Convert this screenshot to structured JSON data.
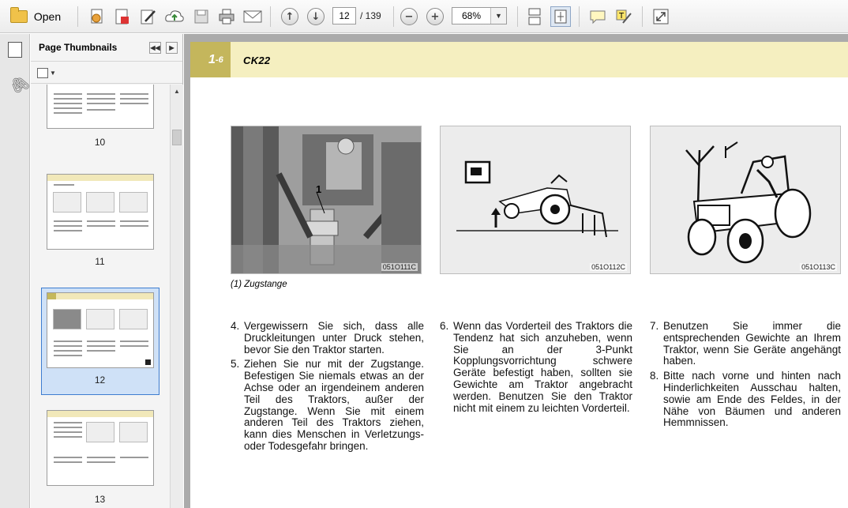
{
  "toolbar": {
    "open_label": "Open",
    "page_current": "12",
    "page_total": "/ 139",
    "zoom": "68%"
  },
  "panel": {
    "title": "Page Thumbnails",
    "thumbnails": [
      {
        "label": "10",
        "selected": false
      },
      {
        "label": "11",
        "selected": false
      },
      {
        "label": "12",
        "selected": true
      },
      {
        "label": "13",
        "selected": false
      }
    ]
  },
  "document": {
    "section_tag": "1",
    "section_tag_sub": "-6",
    "header_title": "CK22",
    "figures": [
      {
        "code": "051O111C",
        "callout": "1"
      },
      {
        "code": "051O112C"
      },
      {
        "code": "051O113C"
      }
    ],
    "caption": "(1)  Zugstange",
    "items": [
      {
        "num": "4.",
        "text": "Vergewissern Sie sich, dass alle Druckleitungen unter Druck stehen, bevor Sie den  Traktor starten."
      },
      {
        "num": "5.",
        "text": "Ziehen Sie nur mit der Zugstange. Befestigen Sie niemals etwas an der Achse oder an irgendeinem anderen Teil des Traktors, außer der Zugstange. Wenn Sie mit einem anderen Teil des Traktors ziehen, kann dies Menschen in Verletzungs- oder Todesgefahr bringen."
      },
      {
        "num": "6.",
        "text": "Wenn das Vorderteil des Traktors die Tendenz hat sich anzuheben, wenn Sie an der 3-Punkt Kopplungsvorrichtung schwere Geräte befestigt haben, sollten sie Gewichte am Traktor angebracht werden. Benutzen Sie den Traktor nicht mit einem zu leichten Vorderteil."
      },
      {
        "num": "7.",
        "text": "Benutzen Sie immer die entsprechenden Gewichte an Ihrem Traktor, wenn Sie Geräte angehängt haben."
      },
      {
        "num": "8.",
        "text": "Bitte nach vorne und hinten nach Hinderlichkeiten Ausschau halten, sowie am Ende des Feldes, in der Nähe von Bäumen und anderen Hemmnissen."
      }
    ]
  },
  "colors": {
    "header_band": "#f5efc0",
    "header_tag": "#c4b65c",
    "selection": "#cfe1f7",
    "doc_background": "#ababab"
  }
}
